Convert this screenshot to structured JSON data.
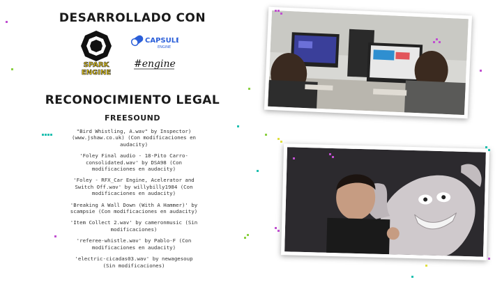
{
  "header": {
    "developed_with": "DESARROLLADO CON"
  },
  "logos": {
    "spark_line1": "SPARK",
    "spark_line2": "ENGINE",
    "capsule_line1": "CAPSULE",
    "capsule_line2": "ENGINE",
    "hengine": "#engine"
  },
  "legal": {
    "title": "RECONOCIMIENTO LEGAL",
    "subtitle": "FREESOUND",
    "credits": [
      "\"Bird Whistling, A.wav\" by Inspector) (www.jshaw.co.uk) (Con modificaciones en audacity)",
      "'Foley Final audio - 18-Pito Carro-consolidated.wav' by DSA98 (Con modificaciones en audacity)",
      "'Foley - RFX_Car Engine, Acelerator and Switch Off.wav' by willybilly1984 (Con modificaciones en audacity)",
      "'Breaking A Wall Down (With A Hammer)' by scampsie (Con modificaciones en audacity)",
      "'Item Collect 2.wav' by cameronmusic (Sin modificaciones)",
      "'referee-whistle.wav' by Pablo-F (Con modificaciones en audacity)",
      "'electric-cicadas03.wav' by newagesoup (Sin modificaciones)"
    ]
  },
  "colors": {
    "spark_yellow": "#f2d21b",
    "capsule_blue": "#2b5fd9",
    "text_dark": "#1a1a1a"
  }
}
